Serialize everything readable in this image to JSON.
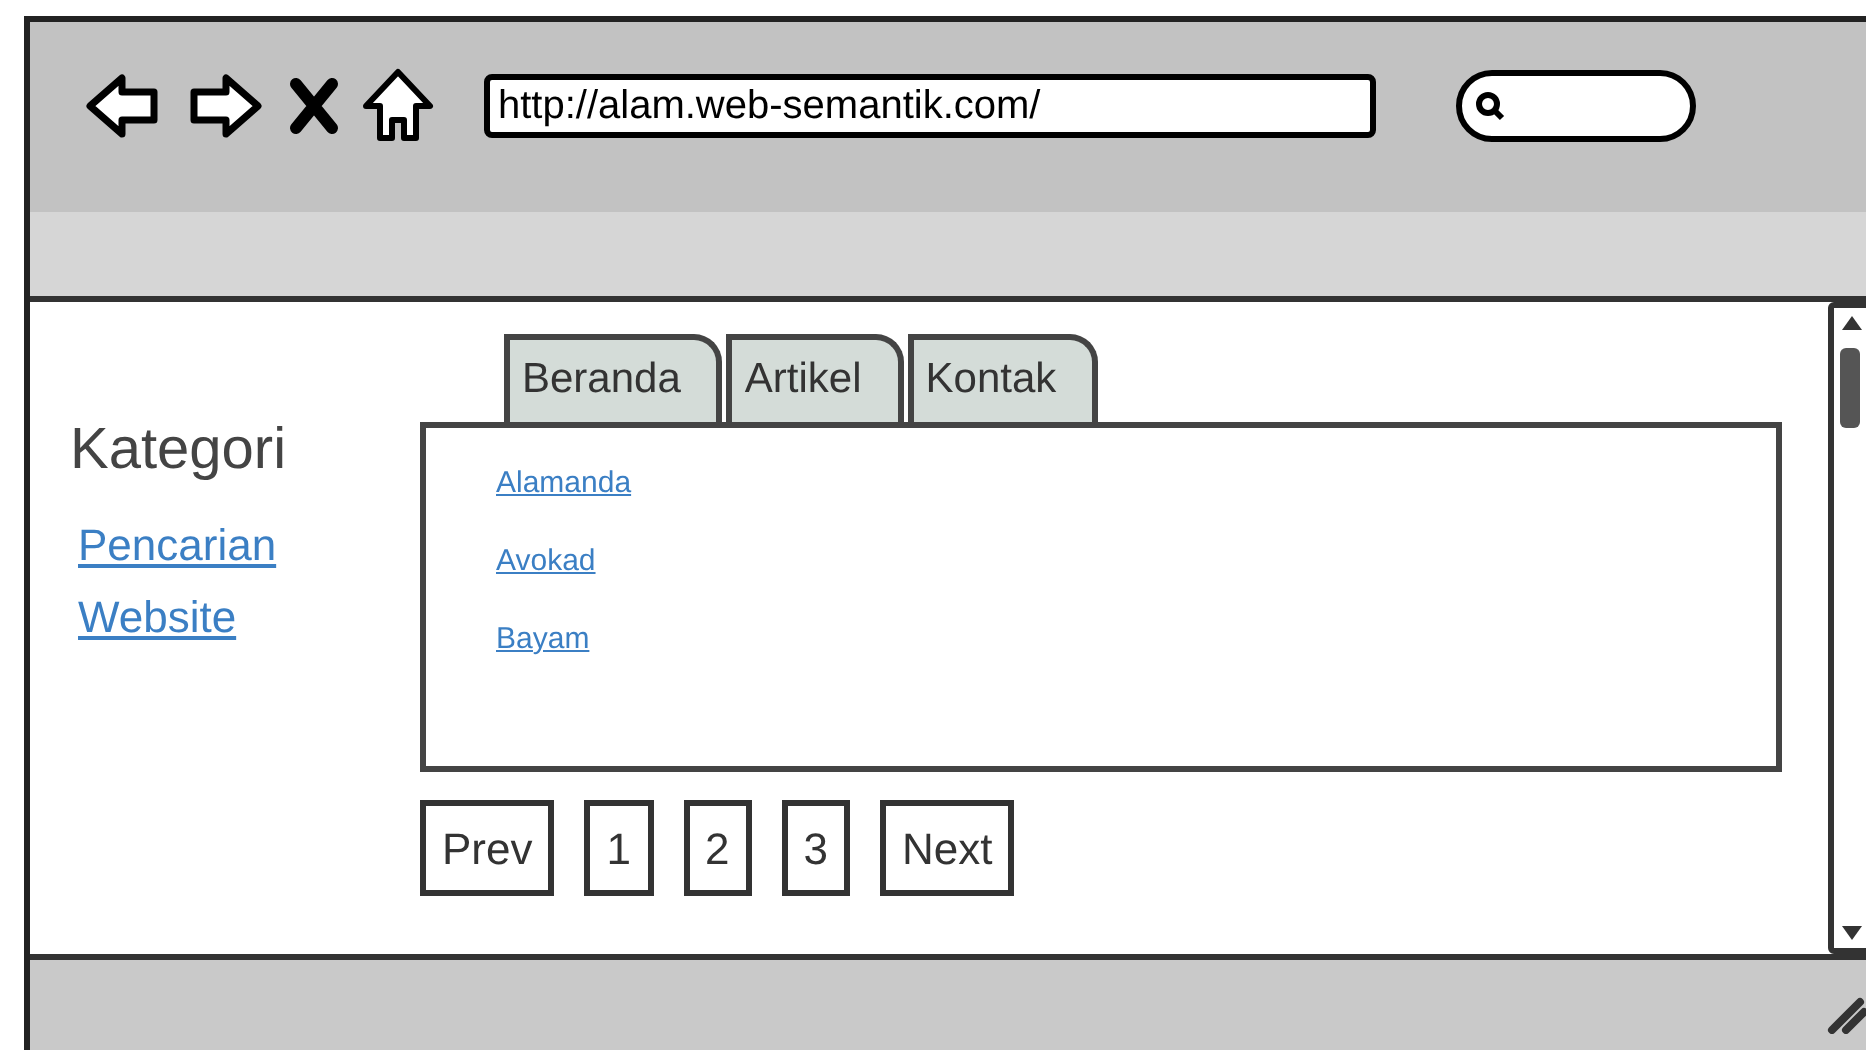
{
  "browser": {
    "url": "http://alam.web-semantik.com/"
  },
  "sidebar": {
    "title": "Kategori",
    "links": [
      "Pencarian",
      "Website"
    ]
  },
  "tabs": [
    {
      "label": "Beranda"
    },
    {
      "label": "Artikel"
    },
    {
      "label": "Kontak"
    }
  ],
  "articles": [
    "Alamanda",
    "Avokad",
    "Bayam"
  ],
  "pagination": [
    "Prev",
    "1",
    "2",
    "3",
    "Next"
  ]
}
